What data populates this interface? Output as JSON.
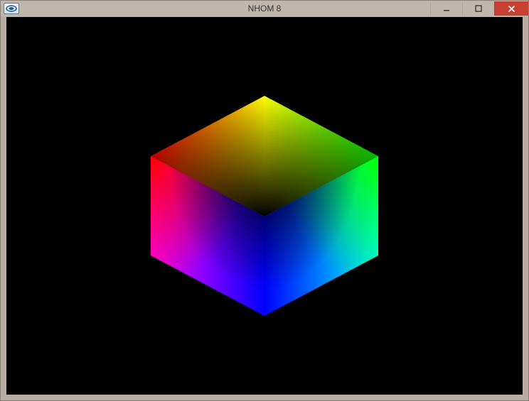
{
  "window": {
    "title": "NHOM 8",
    "icon_name": "opengl-app-icon",
    "min_label": "Minimize",
    "max_label": "Maximize",
    "close_label": "Close"
  },
  "scene": {
    "background": "#000000",
    "object": "rgb-color-cube",
    "vertices": {
      "top": "#ffff00",
      "left_upper": "#ff0000",
      "right_upper": "#00ff00",
      "center": "#000000",
      "left_lower": "#ff00ff",
      "right_lower": "#00ffff",
      "bottom": "#0000ff"
    }
  }
}
